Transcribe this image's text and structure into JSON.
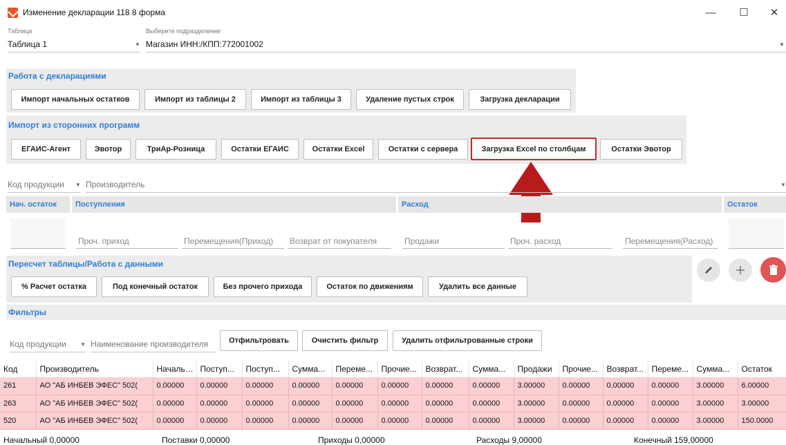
{
  "window": {
    "title": "Изменение декларации 118 8 форма",
    "minimize": "—",
    "maximize": "☐",
    "close": "✕"
  },
  "selectors": {
    "table_label": "Таблица",
    "table_value": "Таблица 1",
    "division_label": "Выберите подразделение",
    "division_value": "Магазин ИНН:/КПП:772001002"
  },
  "work": {
    "header": "Работа с декларациями",
    "buttons": [
      "Импорт начальных остатков",
      "Импорт из таблицы 2",
      "Импорт из таблицы 3",
      "Удаление пустых строк",
      "Загрузка декларации"
    ]
  },
  "import_ext": {
    "header": "Импорт из сторонних программ",
    "buttons": [
      "ЕГАИС-Агент",
      "Эвотор",
      "ТриАр-Розница",
      "Остатки ЕГАИС",
      "Остатки Excel",
      "Остатки с сервера",
      "Загрузка Excel по столбцам",
      "Остатки Эвотор"
    ]
  },
  "product_row": {
    "code_placeholder": "Код продукции",
    "producer_placeholder": "Производитель"
  },
  "fields": {
    "initial_hdr": "Нач. остаток",
    "receipts_hdr": "Поступления",
    "expense_hdr": "Расход",
    "remain_hdr": "Остаток",
    "other_income": "Проч. приход",
    "transfer_in": "Перемещения(Приход)",
    "buyer_return": "Возврат от покупателя",
    "sales": "Продажи",
    "other_expense": "Проч. расход",
    "transfer_out": "Перемещения(Расход)"
  },
  "recalc": {
    "header": "Пересчет таблицы/Работа с данными",
    "buttons": [
      "% Расчет остатка",
      "Под конечный остаток",
      "Без прочего прихода",
      "Остаток по движениям",
      "Удалить все данные"
    ]
  },
  "filters": {
    "header": "Фильтры",
    "code_placeholder": "Код продукции",
    "producer_placeholder": "Наименование производителя",
    "apply": "Отфильтровать",
    "clear": "Очистить фильтр",
    "delete_filtered": "Удалить отфильтрованные строки"
  },
  "table": {
    "headers": [
      "Код",
      "Производитель",
      "Начальн...",
      "Поступ...",
      "Поступ...",
      "Сумма...",
      "Переме...",
      "Прочие...",
      "Возврат...",
      "Сумма...",
      "Продажи",
      "Прочие...",
      "Возврат...",
      "Переме...",
      "Сумма...",
      "Остаток"
    ],
    "rows": [
      [
        "261",
        "АО \"АБ ИНБЕВ ЭФЕС\" 502(",
        "0.00000",
        "0.00000",
        "0.00000",
        "0.00000",
        "0.00000",
        "0.00000",
        "0.00000",
        "0.00000",
        "3.00000",
        "0.00000",
        "0.00000",
        "0.00000",
        "3.00000",
        "6.00000"
      ],
      [
        "263",
        "АО \"АБ ИНБЕВ ЭФЕС\" 502(",
        "0.00000",
        "0.00000",
        "0.00000",
        "0.00000",
        "0.00000",
        "0.00000",
        "0.00000",
        "0.00000",
        "3.00000",
        "0.00000",
        "0.00000",
        "0.00000",
        "3.00000",
        "3.00000"
      ],
      [
        "520",
        "АО \"АБ ИНБЕВ ЭФЕС\" 502(",
        "0.00000",
        "0.00000",
        "0.00000",
        "0.00000",
        "0.00000",
        "0.00000",
        "0.00000",
        "0.00000",
        "3.00000",
        "0.00000",
        "0.00000",
        "0.00000",
        "3.00000",
        "150.0000"
      ]
    ]
  },
  "footer": {
    "initial": "Начальный 0,00000",
    "supplies": "Поставки 0,00000",
    "incomes": "Приходы 0,00000",
    "expenses": "Расходы 9,00000",
    "final": "Конечный 159,00000"
  },
  "colors": {
    "accent": "#2f7ed8",
    "row_highlight": "#fbd0d3",
    "arrow": "#b71c1c",
    "delete_button": "#e05555"
  },
  "icons": {
    "edit": "pencil-icon",
    "add": "plus-icon",
    "delete": "trash-icon",
    "annotation": "arrow-up-icon"
  }
}
